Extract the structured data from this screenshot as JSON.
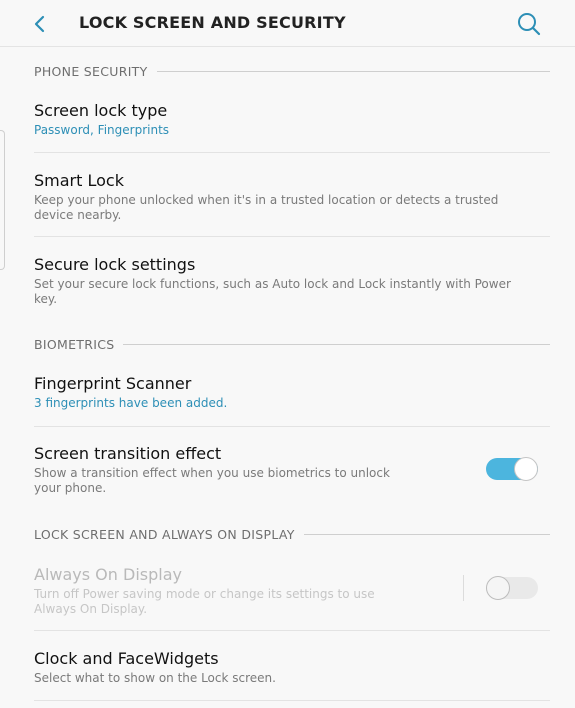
{
  "header": {
    "title": "LOCK SCREEN AND SECURITY",
    "back_icon": "chevron-left-icon",
    "search_icon": "search-icon"
  },
  "colors": {
    "accent": "#2d8fb6",
    "toggle_on": "#4cb5de",
    "background": "#f8f8f8"
  },
  "sections": {
    "phone_security": "PHONE SECURITY",
    "biometrics": "BIOMETRICS",
    "lock_screen": "LOCK SCREEN AND ALWAYS ON DISPLAY"
  },
  "items": {
    "screen_lock_type": {
      "title": "Screen lock type",
      "subtitle": "Password, Fingerprints"
    },
    "smart_lock": {
      "title": "Smart Lock",
      "subtitle": "Keep your phone unlocked when it's in a trusted location or detects a trusted device nearby."
    },
    "secure_lock_settings": {
      "title": "Secure lock settings",
      "subtitle": "Set your secure lock functions, such as Auto lock and Lock instantly with Power key."
    },
    "fingerprint_scanner": {
      "title": "Fingerprint Scanner",
      "subtitle": "3 fingerprints have been added."
    },
    "screen_transition_effect": {
      "title": "Screen transition effect",
      "subtitle": "Show a transition effect when you use biometrics to unlock your phone.",
      "enabled": true
    },
    "always_on_display": {
      "title": "Always On Display",
      "subtitle": "Turn off Power saving mode or change its settings to use Always On Display.",
      "enabled": false,
      "disabled": true
    },
    "clock_facewidgets": {
      "title": "Clock and FaceWidgets",
      "subtitle": "Select what to show on the Lock screen."
    }
  }
}
